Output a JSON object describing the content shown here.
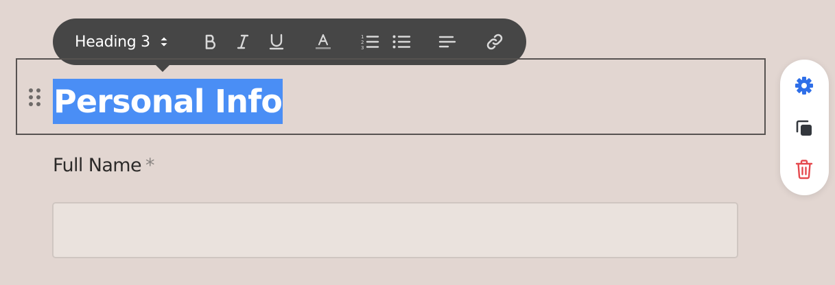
{
  "toolbar": {
    "block_type_selected": "Heading 3",
    "icons": {
      "block_type_toggle": "chevron-up-down-icon",
      "bold": "bold-icon",
      "italic": "italic-icon",
      "underline": "underline-icon",
      "text_color": "text-color-icon",
      "ordered_list": "ordered-list-icon",
      "bullet_list": "bullet-list-icon",
      "align": "align-left-icon",
      "link": "link-icon"
    },
    "background_color": "#464646"
  },
  "heading_block": {
    "text": "Personal Info",
    "selection_color": "#4a8ef5"
  },
  "field": {
    "label": "Full Name",
    "required_mark": "*",
    "value": "",
    "placeholder": ""
  },
  "side_actions": {
    "icons": [
      "gear-icon",
      "duplicate-icon",
      "trash-icon"
    ],
    "colors": {
      "settings": "#2f6fe8",
      "duplicate": "#33373d",
      "delete": "#e5484d"
    }
  }
}
